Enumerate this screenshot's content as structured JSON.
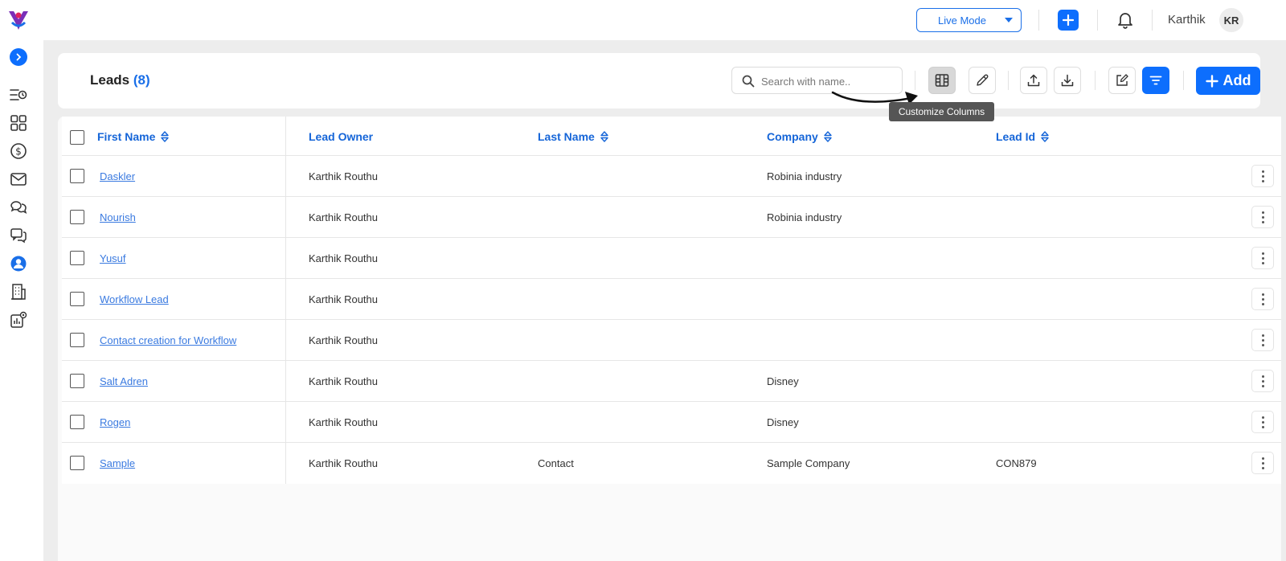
{
  "topbar": {
    "mode_label": "Live Mode",
    "user_name": "Karthik",
    "avatar_initials": "KR"
  },
  "sidebar": {
    "items": [
      {
        "icon": "activity-list-icon"
      },
      {
        "icon": "dashboard-grid-icon"
      },
      {
        "icon": "dollar-icon"
      },
      {
        "icon": "mail-icon"
      },
      {
        "icon": "chat-bubbles-icon"
      },
      {
        "icon": "conversation-icon"
      },
      {
        "icon": "contact-person-icon",
        "active": true
      },
      {
        "icon": "building-icon"
      },
      {
        "icon": "reports-settings-icon"
      }
    ]
  },
  "header": {
    "title": "Leads",
    "count": "(8)",
    "search_placeholder": "Search with name..",
    "add_label": "Add",
    "tooltip": "Customize Columns"
  },
  "colors": {
    "primary": "#0d6efd",
    "link": "#3a7ae0",
    "header_text": "#1565d8"
  },
  "table": {
    "columns": [
      "First Name",
      "Lead Owner",
      "Last Name",
      "Company",
      "Lead Id"
    ],
    "rows": [
      {
        "first_name": "Daskler",
        "lead_owner": "Karthik Routhu",
        "last_name": "",
        "company": "Robinia industry",
        "lead_id": ""
      },
      {
        "first_name": "Nourish",
        "lead_owner": "Karthik Routhu",
        "last_name": "",
        "company": "Robinia industry",
        "lead_id": ""
      },
      {
        "first_name": "Yusuf",
        "lead_owner": "Karthik Routhu",
        "last_name": "",
        "company": "",
        "lead_id": ""
      },
      {
        "first_name": "Workflow Lead",
        "lead_owner": "Karthik Routhu",
        "last_name": "",
        "company": "",
        "lead_id": ""
      },
      {
        "first_name": "Contact creation for Workflow",
        "lead_owner": "Karthik Routhu",
        "last_name": "",
        "company": "",
        "lead_id": ""
      },
      {
        "first_name": "Salt Adren",
        "lead_owner": "Karthik Routhu",
        "last_name": "",
        "company": "Disney",
        "lead_id": ""
      },
      {
        "first_name": "Rogen",
        "lead_owner": "Karthik Routhu",
        "last_name": "",
        "company": "Disney",
        "lead_id": ""
      },
      {
        "first_name": "Sample",
        "lead_owner": "Karthik Routhu",
        "last_name": "Contact",
        "company": "Sample Company",
        "lead_id": "CON879"
      }
    ]
  }
}
